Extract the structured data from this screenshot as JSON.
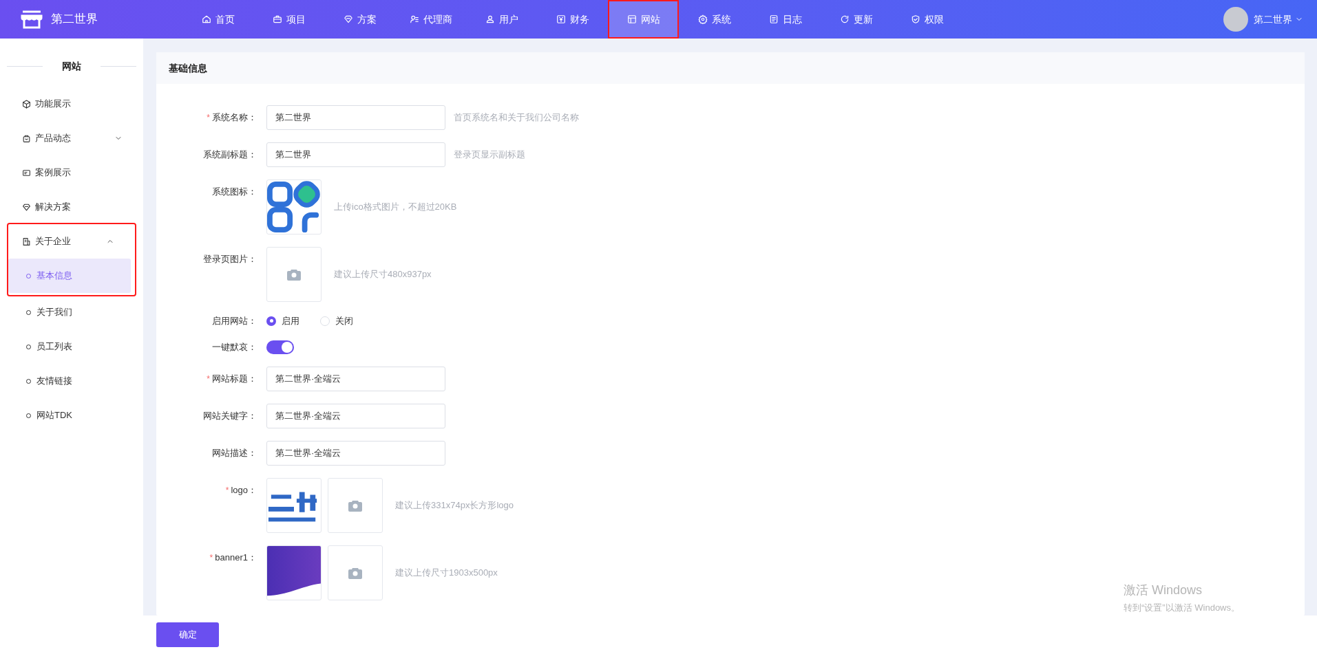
{
  "brand": {
    "name": "第二世界"
  },
  "nav": [
    {
      "label": "首页",
      "selected": false,
      "annotated": false
    },
    {
      "label": "项目",
      "selected": false,
      "annotated": false
    },
    {
      "label": "方案",
      "selected": false,
      "annotated": false
    },
    {
      "label": "代理商",
      "selected": false,
      "annotated": false
    },
    {
      "label": "用户",
      "selected": false,
      "annotated": false
    },
    {
      "label": "财务",
      "selected": false,
      "annotated": false
    },
    {
      "label": "网站",
      "selected": true,
      "annotated": true
    },
    {
      "label": "系统",
      "selected": false,
      "annotated": false
    },
    {
      "label": "日志",
      "selected": false,
      "annotated": false
    },
    {
      "label": "更新",
      "selected": false,
      "annotated": false
    },
    {
      "label": "权限",
      "selected": false,
      "annotated": false
    }
  ],
  "account": {
    "name": "第二世界"
  },
  "sidebar": {
    "title": "网站",
    "items": [
      {
        "label": "功能展示",
        "selected": false,
        "annotated": false
      },
      {
        "label": "产品动态",
        "expanded": false,
        "selected": false,
        "annotated": false
      },
      {
        "label": "案例展示",
        "selected": false,
        "annotated": false
      },
      {
        "label": "解决方案",
        "selected": false,
        "annotated": false
      },
      {
        "label": "关于企业",
        "expanded": true,
        "selected": false,
        "annotated": true,
        "children": [
          {
            "label": "基本信息",
            "selected": true
          },
          {
            "label": "关于我们",
            "selected": false
          },
          {
            "label": "员工列表",
            "selected": false
          },
          {
            "label": "友情链接",
            "selected": false
          },
          {
            "label": "网站TDK",
            "selected": false
          }
        ]
      }
    ]
  },
  "card": {
    "title": "基础信息"
  },
  "form": [
    {
      "kind": "text",
      "label": "系统名称：",
      "required_mark": "*",
      "value": "第二世界",
      "hint": "首页系统名和关于我们公司名称"
    },
    {
      "kind": "text",
      "label": "系统副标题：",
      "value": "第二世界",
      "hint": "登录页显示副标题"
    },
    {
      "kind": "image",
      "label": "系统图标：",
      "preview": true,
      "upload": false,
      "hint": "上传ico格式图片，不超过20KB"
    },
    {
      "kind": "image",
      "label": "登录页图片：",
      "preview": false,
      "upload": true,
      "hint": "建议上传尺寸480x937px"
    },
    {
      "kind": "radio",
      "label": "启用网站：",
      "options": [
        {
          "label": "启用",
          "selected": true
        },
        {
          "label": "关闭",
          "selected": false
        }
      ]
    },
    {
      "kind": "switch",
      "label": "一键默哀：",
      "on": true
    },
    {
      "kind": "text",
      "label": "网站标题：",
      "required_mark": "*",
      "value": "第二世界·全端云"
    },
    {
      "kind": "text",
      "label": "网站关键字：",
      "value": "第二世界·全端云"
    },
    {
      "kind": "text",
      "label": "网站描述：",
      "value": "第二世界·全端云"
    },
    {
      "kind": "image",
      "label": "logo：",
      "required_mark": "*",
      "preview": true,
      "upload": true,
      "hint": "建议上传331x74px长方形logo"
    },
    {
      "kind": "image",
      "label": "banner1：",
      "required_mark": "*",
      "preview": true,
      "upload": true,
      "hint": "建议上传尺寸1903x500px"
    }
  ],
  "submit": {
    "label": "确定"
  },
  "os_notice": {
    "title": "激活 Windows",
    "subtitle": "转到“设置”以激活 Windows。"
  }
}
